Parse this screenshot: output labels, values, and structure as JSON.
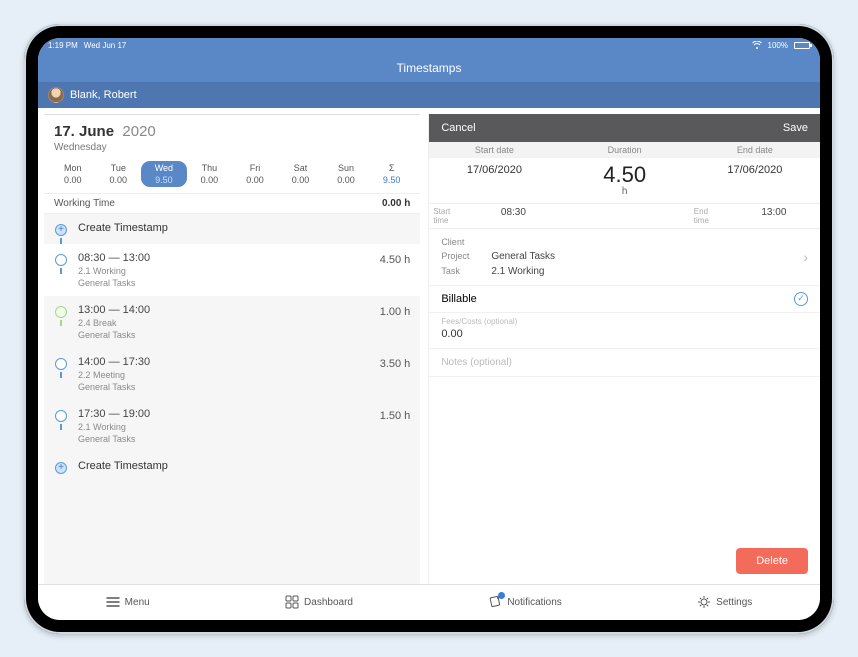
{
  "status": {
    "time": "1:19 PM",
    "date": "Wed Jun 17",
    "battery": "100%"
  },
  "app_title": "Timestamps",
  "user": "Blank, Robert",
  "date_header": {
    "day": "17.",
    "month": "June",
    "year": "2020",
    "weekday": "Wednesday"
  },
  "week": [
    {
      "label": "Mon",
      "value": "0.00"
    },
    {
      "label": "Tue",
      "value": "0.00"
    },
    {
      "label": "Wed",
      "value": "9.50",
      "active": true
    },
    {
      "label": "Thu",
      "value": "0.00"
    },
    {
      "label": "Fri",
      "value": "0.00"
    },
    {
      "label": "Sat",
      "value": "0.00"
    },
    {
      "label": "Sun",
      "value": "0.00"
    },
    {
      "label": "Σ",
      "value": "9.50"
    }
  ],
  "working_time": {
    "label": "Working Time",
    "value": "0.00 h"
  },
  "create_label": "Create Timestamp",
  "entries": [
    {
      "time": "08:30 — 13:00",
      "task": "2.1 Working",
      "project": "General Tasks",
      "hours": "4.50 h",
      "active": true
    },
    {
      "time": "13:00 — 14:00",
      "task": "2.4 Break",
      "project": "General Tasks",
      "hours": "1.00 h",
      "break": true
    },
    {
      "time": "14:00 — 17:30",
      "task": "2.2 Meeting",
      "project": "General Tasks",
      "hours": "3.50 h"
    },
    {
      "time": "17:30 — 19:00",
      "task": "2.1 Working",
      "project": "General Tasks",
      "hours": "1.50 h"
    }
  ],
  "detail": {
    "cancel": "Cancel",
    "save": "Save",
    "cols": {
      "start": "Start date",
      "duration": "Duration",
      "end": "End date"
    },
    "start_date": "17/06/2020",
    "duration_val": "4.50",
    "duration_unit": "h",
    "end_date": "17/06/2020",
    "start_time_lab": "Start time",
    "start_time": "08:30",
    "end_time_lab": "End time",
    "end_time": "13:00",
    "client_lab": "Client",
    "client_val": "",
    "project_lab": "Project",
    "project_val": "General Tasks",
    "task_lab": "Task",
    "task_val": "2.1 Working",
    "billable": "Billable",
    "fees_lab": "Fees/Costs (optional)",
    "fees_val": "0.00",
    "notes_placeholder": "Notes (optional)",
    "delete": "Delete"
  },
  "tabs": {
    "menu": "Menu",
    "dashboard": "Dashboard",
    "notifications": "Notifications",
    "settings": "Settings"
  }
}
